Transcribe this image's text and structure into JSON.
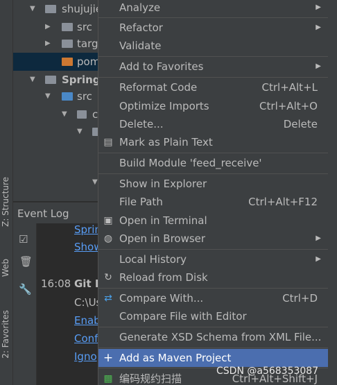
{
  "side_tabs": {
    "structure": "Z: Structure",
    "web": "Web",
    "favorites": "2: Favorites"
  },
  "tree": {
    "rows": [
      {
        "label": "shujujie"
      },
      {
        "label": "src"
      },
      {
        "label": "targ"
      },
      {
        "label": "pom"
      },
      {
        "label": "Spring"
      },
      {
        "label": "src"
      },
      {
        "label": "c"
      }
    ]
  },
  "event_log": {
    "title": "Event Log",
    "line1": "Sprin",
    "line2": "Show",
    "time": "16:08",
    "git": "Git R",
    "path": "C:\\Us",
    "enable": "Enab",
    "config": "Conf",
    "ignore": "Igno"
  },
  "menu": {
    "analyze": "Analyze",
    "refactor": "Refactor",
    "validate": "Validate",
    "add_favorites": "Add to Favorites",
    "reformat": "Reformat Code",
    "reformat_sc": "Ctrl+Alt+L",
    "optimize": "Optimize Imports",
    "optimize_sc": "Ctrl+Alt+O",
    "delete": "Delete...",
    "delete_sc": "Delete",
    "mark_plain": "Mark as Plain Text",
    "build_module": "Build Module 'feed_receive'",
    "show_explorer": "Show in Explorer",
    "file_path": "File Path",
    "file_path_sc": "Ctrl+Alt+F12",
    "open_terminal": "Open in Terminal",
    "open_browser": "Open in Browser",
    "local_history": "Local History",
    "reload": "Reload from Disk",
    "compare_with": "Compare With...",
    "compare_with_sc": "Ctrl+D",
    "compare_editor": "Compare File with Editor",
    "generate_xsd": "Generate XSD Schema from XML File...",
    "add_maven": "Add as Maven Project",
    "scan": "编码规约扫描",
    "scan_sc": "Ctrl+Alt+Shift+J"
  },
  "watermark": "CSDN @a568353087",
  "colors": {
    "highlight": "#4b6eaf",
    "menu_bg": "#3c3f41",
    "link": "#589df6"
  }
}
